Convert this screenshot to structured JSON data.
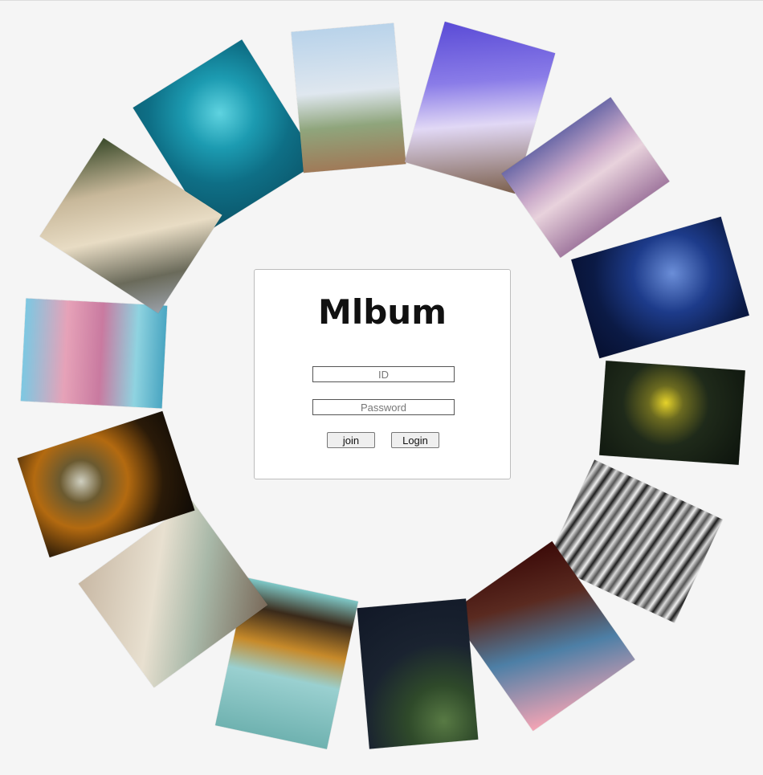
{
  "login": {
    "title": "Mlbum",
    "id_placeholder": "ID",
    "password_placeholder": "Password",
    "join_label": "join",
    "login_label": "Login"
  },
  "photos": [
    {
      "name": "photo-ocean-aerial",
      "bg": "radial-gradient(circle at 55% 35%, #5fd3e0 0%, #1c9bb1 30%, #0e6f86 60%, #0b5468 100%)"
    },
    {
      "name": "photo-couple-street",
      "bg": "linear-gradient(180deg, #b9d3ea 0%, #dfe7ef 45%, #8fa57c 70%, #a07a58 100%)"
    },
    {
      "name": "photo-purple-smoke",
      "bg": "linear-gradient(160deg, #5a4bd6 0%, #8a7ce8 35%, #e1d8f5 60%, #7b5f4c 100%)"
    },
    {
      "name": "photo-pink-sky-lake",
      "bg": "linear-gradient(180deg, #6d6aa8 0%, #c9a9c9 35%, #e8d2dc 55%, #a27aa0 100%)"
    },
    {
      "name": "photo-blue-forest-moon",
      "bg": "radial-gradient(circle at 60% 40%, #6b8ed8 0%, #1d3b8a 35%, #0b1a45 70%, #071030 100%)"
    },
    {
      "name": "photo-man-yellow-smoke",
      "bg": "radial-gradient(circle at 45% 40%, #e6d32a 0%, #6b6a20 18%, #1f2a1a 45%, #0d140d 100%)"
    },
    {
      "name": "photo-waterfall-bw",
      "bg": "repeating-linear-gradient(100deg, #1a1a1a 0px, #d9d9d9 6px, #555 12px, #efefef 18px, #222 24px)"
    },
    {
      "name": "photo-gradient-pink",
      "bg": "linear-gradient(200deg, #3b0a08 0%, #5a2a20 30%, #4d7fa6 60%, #f5a4b4 100%)"
    },
    {
      "name": "photo-snow-green",
      "bg": "radial-gradient(circle at 70% 85%, #587a44 0%, #2f4a2a 25%, #1a2330 55%, #111827 100%)"
    },
    {
      "name": "photo-tiles-bowl",
      "bg": "linear-gradient(180deg, #7fc9c8 0%, #3a2a1a 18%, #c78a2a 40%, #9ad0d0 60%, #6fb2b0 100%)"
    },
    {
      "name": "photo-ornate-room",
      "bg": "linear-gradient(135deg, #c8b8a4 0%, #e8e0d0 40%, #a8b8a8 65%, #7a6a5a 100%)"
    },
    {
      "name": "photo-bird-golden",
      "bg": "radial-gradient(circle at 35% 40%, #cfcfc0 0%, #6b5a30 18%, #b36a10 40%, #2a1a08 70%, #0f0a05 100%)"
    },
    {
      "name": "photo-ice-cream-shop",
      "bg": "linear-gradient(90deg, #7cc8e2 0%, #e6a2b8 30%, #c97aa0 55%, #8fd3e0 80%, #4aa6c2 100%)"
    },
    {
      "name": "photo-pampas-grass",
      "bg": "linear-gradient(135deg, #3a4a2a 0%, #c8b89a 30%, #e8dcc4 55%, #6a6a5a 80%, #9aa0a8 100%)"
    }
  ]
}
